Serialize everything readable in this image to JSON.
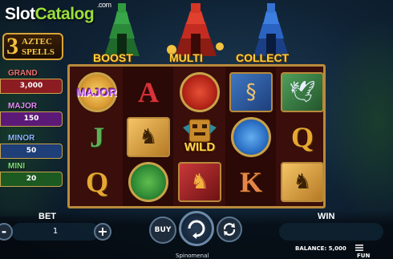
{
  "watermark": {
    "part1": "Slot",
    "part2": "Catalog",
    "suffix": ".com"
  },
  "game_logo": {
    "number": "3",
    "line1": "AZTEC",
    "line2": "SPELLS"
  },
  "jackpots": [
    {
      "label": "GRAND",
      "value": "3,000",
      "color": "#d8353a",
      "label_color": "#f36e6e"
    },
    {
      "label": "MAJOR",
      "value": "150",
      "color": "#8d2fb0",
      "label_color": "#e28cf5"
    },
    {
      "label": "MINOR",
      "value": "50",
      "color": "#2f64b8",
      "label_color": "#8ab9ff"
    },
    {
      "label": "MINI",
      "value": "20",
      "color": "#2f8a34",
      "label_color": "#7ee07a"
    }
  ],
  "features": [
    {
      "label": "BOOST",
      "color": "#2b8a3a"
    },
    {
      "label": "MULTI",
      "color": "#c42c22"
    },
    {
      "label": "COLLECT",
      "color": "#2a63c2"
    }
  ],
  "reels": {
    "cells": [
      [
        "disc-gold-major",
        "letter-j",
        "letter-q"
      ],
      [
        "letter-a",
        "tile-gold-monkey",
        "disc-green"
      ],
      [
        "disc-red",
        "wild",
        "tile-red-jaguar"
      ],
      [
        "tile-blue-serpent",
        "disc-blue",
        "letter-k"
      ],
      [
        "tile-green-bird",
        "letter-q",
        "tile-gold-monkey"
      ]
    ],
    "letters": {
      "a": "A",
      "j": "J",
      "q": "Q",
      "k": "K"
    },
    "major_text": "MAJOR",
    "wild_text": "WILD"
  },
  "controls": {
    "bet_label": "BET",
    "bet_value": "1",
    "minus": "-",
    "plus": "+",
    "buy_label": "BUY",
    "win_label": "WIN",
    "balance_text": "BALANCE: 5,000",
    "mode_text": "FUN",
    "provider": "Spinomenal"
  },
  "icons": [
    "spin-icon",
    "autoplay-icon",
    "menu-icon",
    "pyramid-icon"
  ]
}
